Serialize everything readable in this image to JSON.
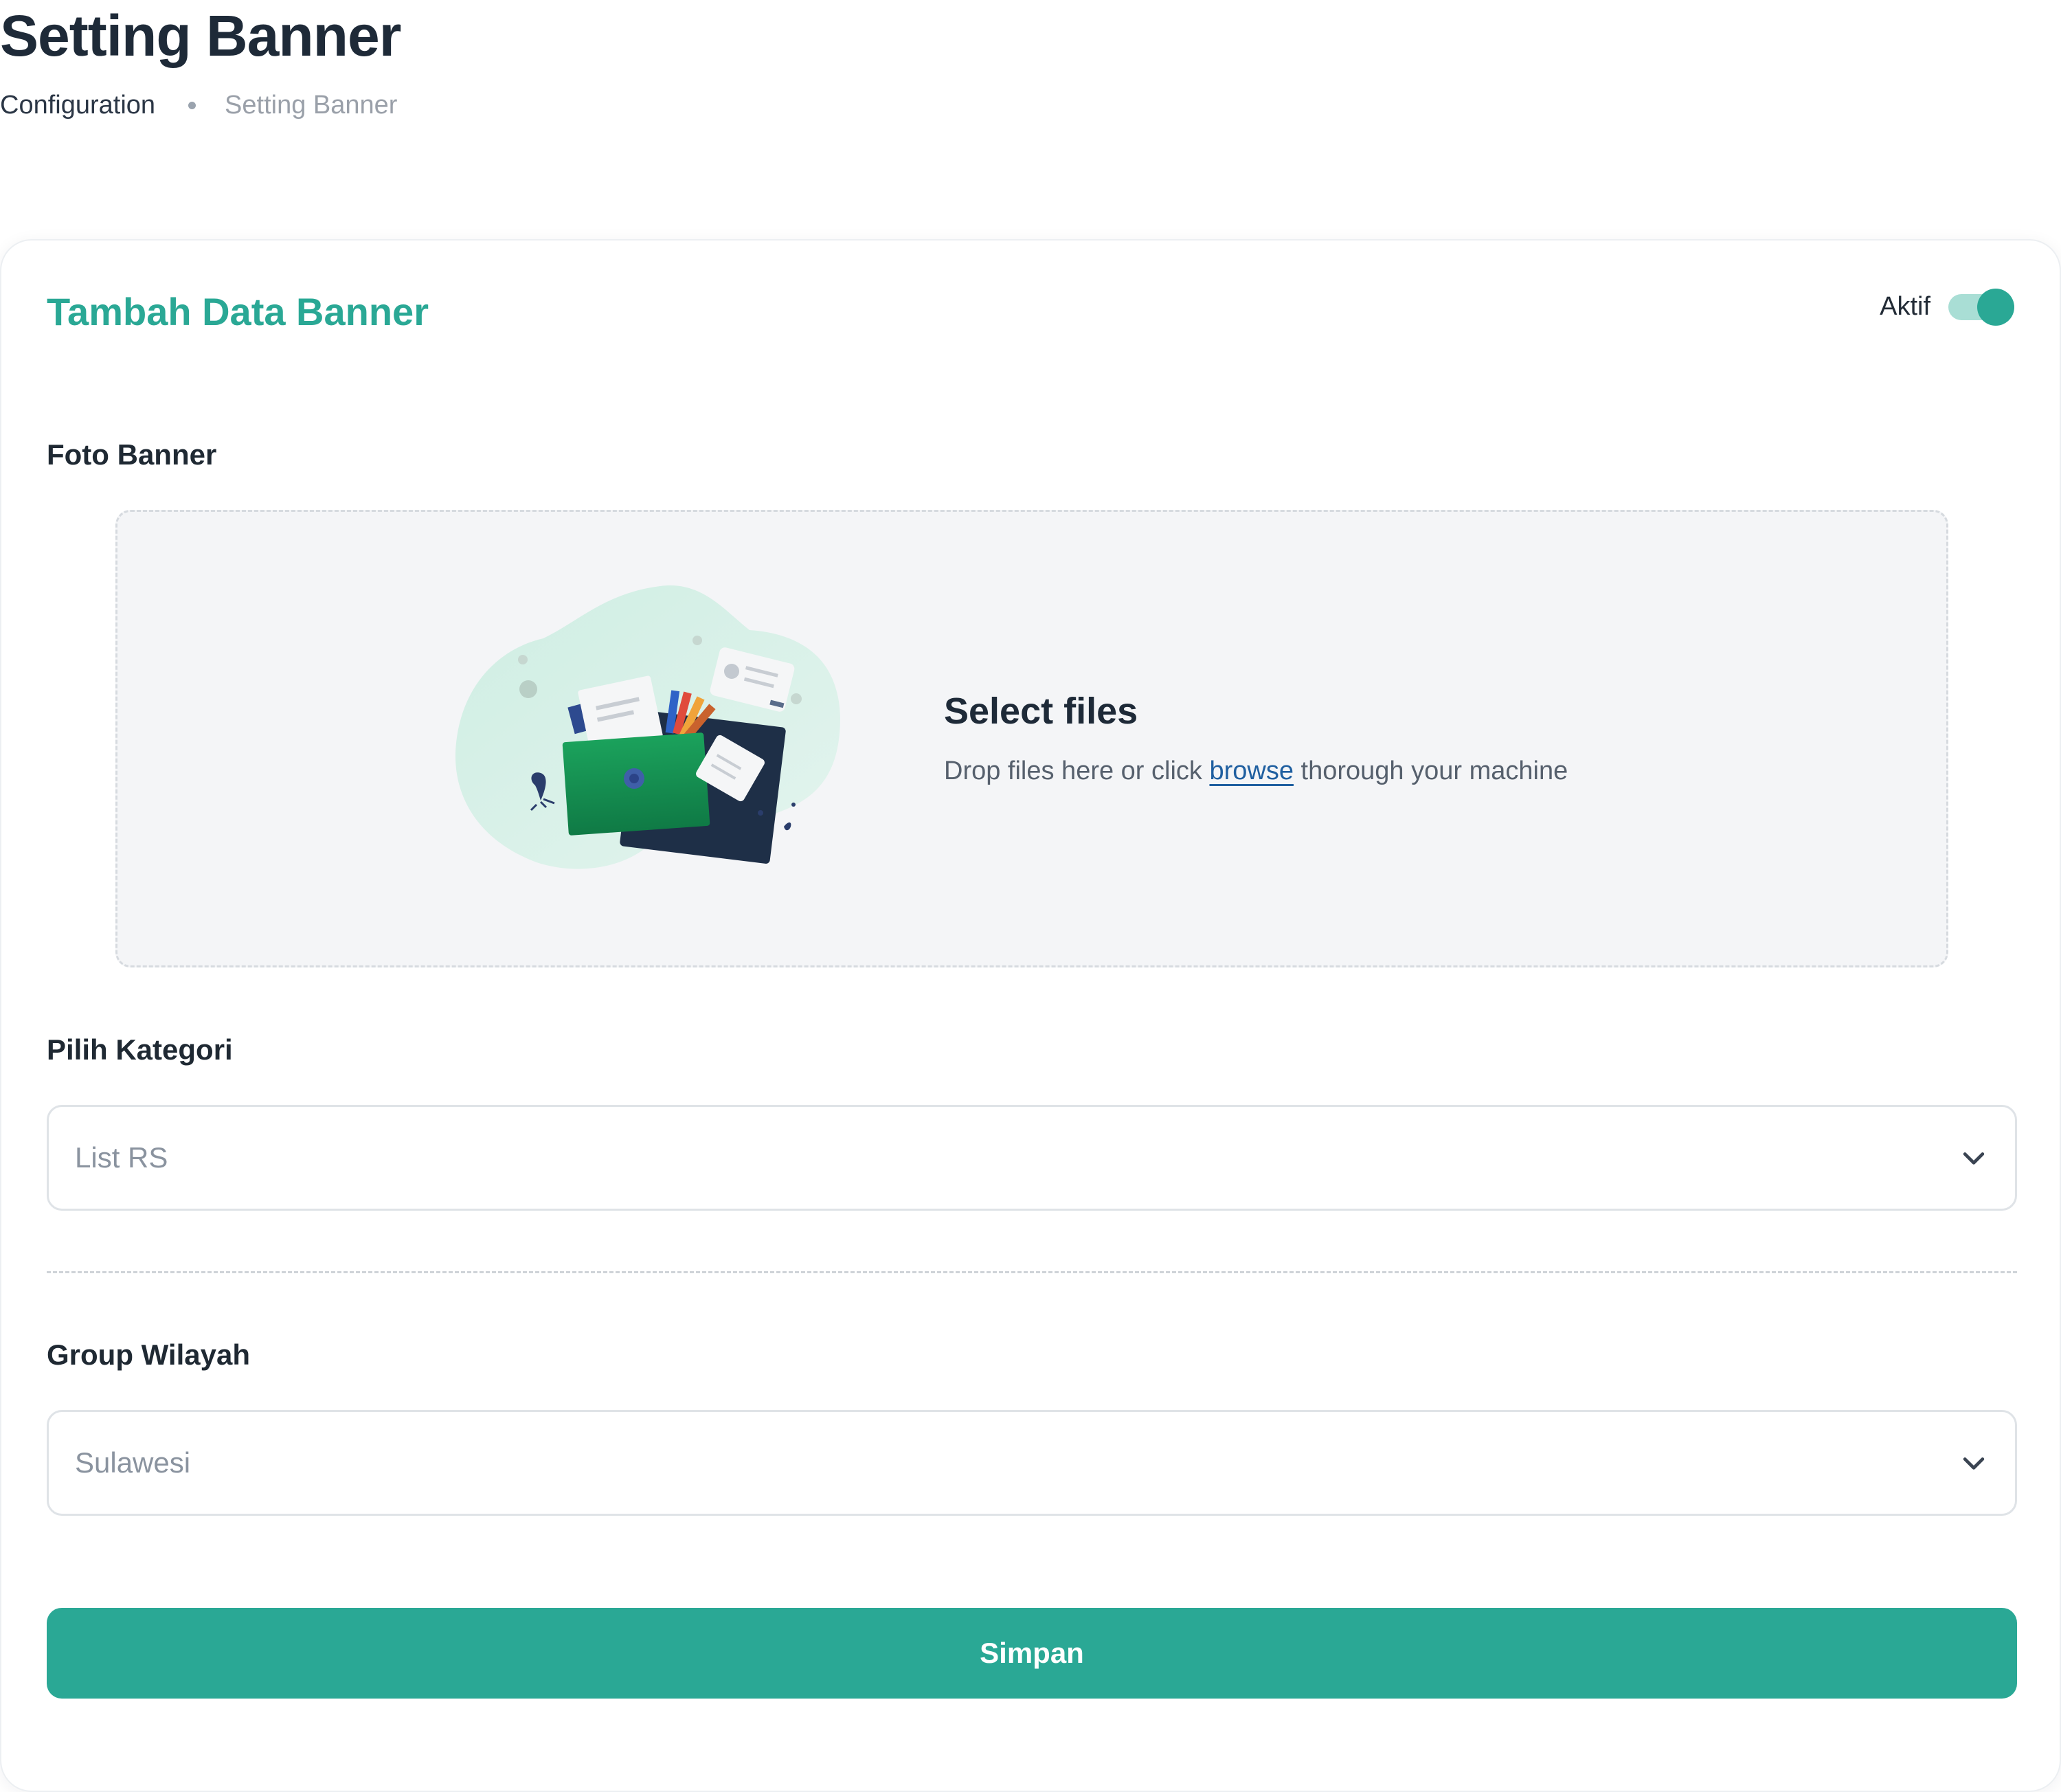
{
  "page": {
    "title": "Setting Banner"
  },
  "breadcrumb": {
    "items": [
      "Configuration",
      "Setting Banner"
    ]
  },
  "form": {
    "title": "Tambah Data Banner",
    "status_label": "Aktif",
    "status_enabled": true,
    "colors": {
      "accent": "#2aa895",
      "accent_light": "#a9ded5",
      "link": "#1f5fa0",
      "heading": "#1e2a38"
    },
    "photo": {
      "label": "Foto Banner",
      "dropzone_title": "Select files",
      "dropzone_text_before": "Drop files here or click ",
      "dropzone_link": "browse",
      "dropzone_text_after": " thorough your machine",
      "illustration_icon": "folder-upload-illustration"
    },
    "category": {
      "label": "Pilih Kategori",
      "value": "List RS",
      "icon": "chevron-down-icon"
    },
    "region": {
      "label": "Group Wilayah",
      "value": "Sulawesi",
      "icon": "chevron-down-icon"
    },
    "submit_label": "Simpan"
  }
}
